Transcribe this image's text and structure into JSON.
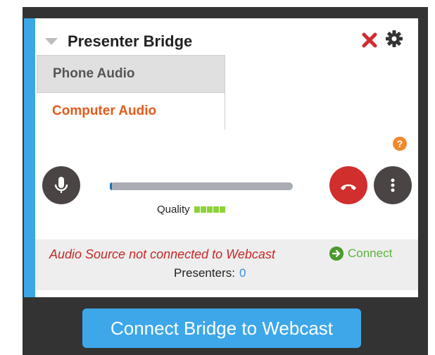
{
  "panel": {
    "title": "Presenter Bridge",
    "menu_items": [
      {
        "label": "Phone Audio",
        "state": "active"
      },
      {
        "label": "Computer Audio",
        "state": "inactive"
      }
    ],
    "help_label": "?",
    "quality_label": "Quality",
    "quality_level": 5,
    "audio_level": 0.01,
    "status_message": "Audio Source not connected to Webcast",
    "connect_label": "Connect",
    "presenters_label": "Presenters:",
    "presenters_count": "0"
  },
  "footer": {
    "bridge_button_label": "Connect Bridge to Webcast"
  },
  "colors": {
    "accent": "#3ba8e6",
    "error": "#c62828",
    "success": "#5db33c",
    "hangup": "#d12e2e",
    "computer_audio": "#e55a1b"
  },
  "icons": {
    "collapse": "triangle-down-icon",
    "close": "close-icon",
    "settings": "gear-icon",
    "help": "help-icon",
    "mic": "microphone-icon",
    "hangup": "phone-hangup-icon",
    "more": "more-vertical-icon",
    "connect": "arrow-right-circle-icon"
  }
}
